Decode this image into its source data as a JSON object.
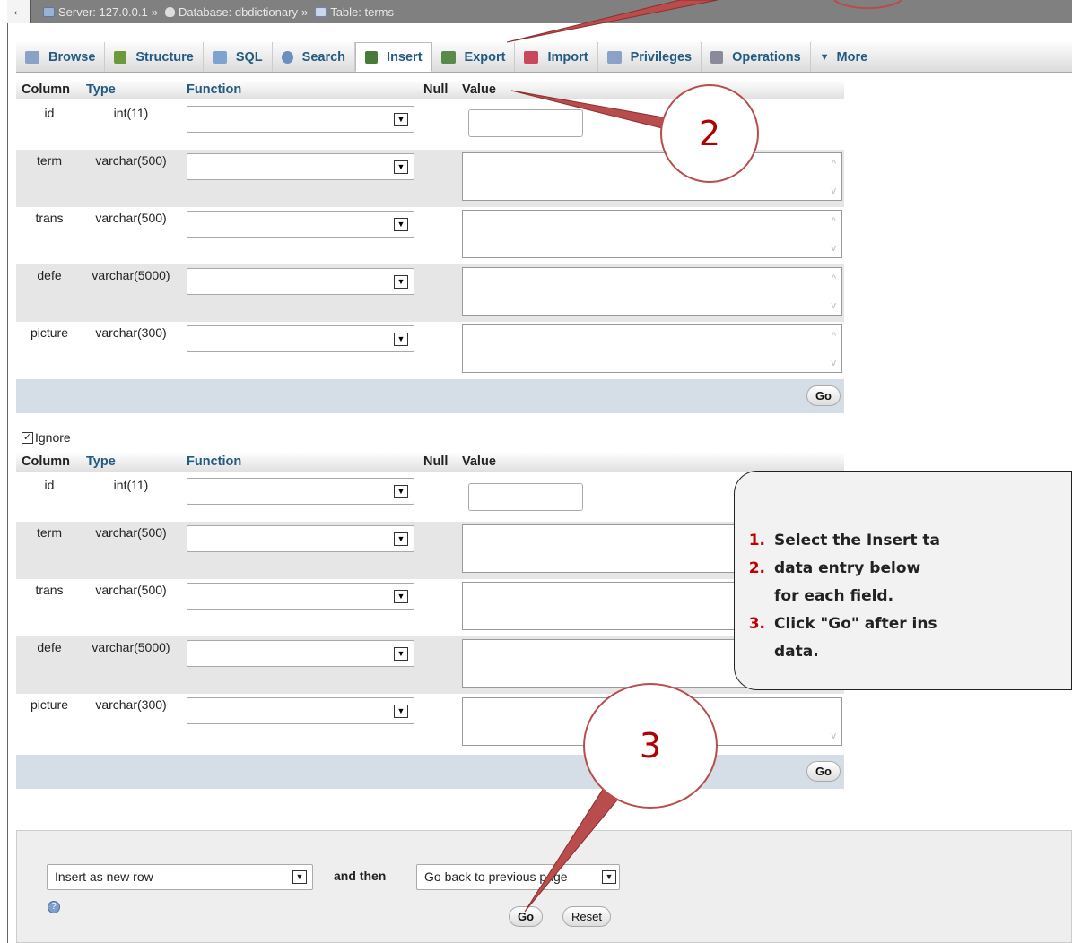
{
  "breadcrumb": {
    "back_glyph": "←",
    "server_label": "Server: 127.0.0.1",
    "sep1": "»",
    "database_label": "Database: dbdictionary",
    "sep2": "»",
    "table_label": "Table: terms"
  },
  "tabs": [
    {
      "label": "Browse",
      "icon": "browse-icon",
      "color": "#8aa2c8"
    },
    {
      "label": "Structure",
      "icon": "structure-icon",
      "color": "#6a9a3a"
    },
    {
      "label": "SQL",
      "icon": "sql-icon",
      "color": "#7fa3cf"
    },
    {
      "label": "Search",
      "icon": "search-icon",
      "color": "#6d8fbf"
    },
    {
      "label": "Insert",
      "icon": "insert-icon",
      "color": "#4a7a3a",
      "active": true
    },
    {
      "label": "Export",
      "icon": "export-icon",
      "color": "#5a8a4a"
    },
    {
      "label": "Import",
      "icon": "import-icon",
      "color": "#c84a5a"
    },
    {
      "label": "Privileges",
      "icon": "privileges-icon",
      "color": "#8aa2c8"
    },
    {
      "label": "Operations",
      "icon": "operations-icon",
      "color": "#8a8a9a"
    },
    {
      "label": "More",
      "icon": "caret-down-icon",
      "color": "#333"
    }
  ],
  "headers": {
    "column": "Column",
    "type": "Type",
    "function": "Function",
    "null": "Null",
    "value": "Value"
  },
  "rows": [
    {
      "column": "id",
      "type": "int(11)"
    },
    {
      "column": "term",
      "type": "varchar(500)"
    },
    {
      "column": "trans",
      "type": "varchar(500)"
    },
    {
      "column": "defe",
      "type": "varchar(5000)"
    },
    {
      "column": "picture",
      "type": "varchar(300)"
    }
  ],
  "go_label": "Go",
  "ignore_label": "Ignore",
  "bottom": {
    "insert_mode": "Insert as new row",
    "and_then": "and then",
    "after_action": "Go back to previous page",
    "go_label": "Go",
    "reset_label": "Reset"
  },
  "callout": {
    "items": [
      {
        "num": "1.",
        "text": "Select the Insert ta"
      },
      {
        "num": "2.",
        "text": "data  entry  below "
      },
      {
        "num": "",
        "text": "for each field."
      },
      {
        "num": "3.",
        "text": "Click \"Go\" after ins"
      },
      {
        "num": "",
        "text": "data."
      }
    ]
  },
  "bubbles": {
    "two": "2",
    "three": "3"
  },
  "colors": {
    "accent_red": "#b94c4c",
    "tab_text": "#235a81"
  }
}
